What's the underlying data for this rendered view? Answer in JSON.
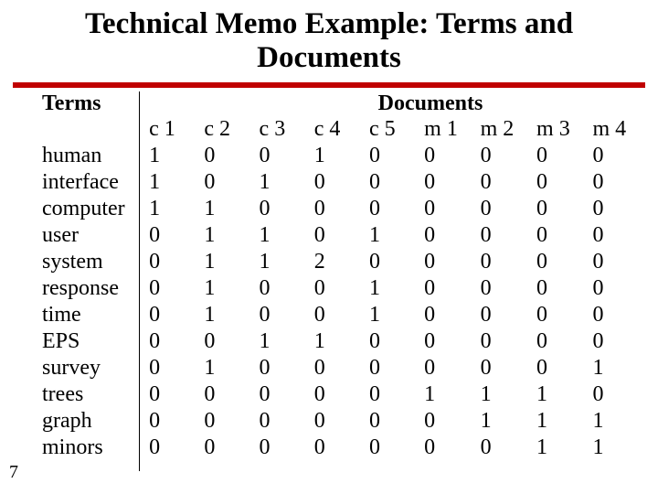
{
  "title_line1": "Technical Memo Example: Terms and",
  "title_line2": "Documents",
  "header_terms": "Terms",
  "header_docs": "Documents",
  "page_number": "7",
  "columns": [
    "c 1",
    "c 2",
    "c 3",
    "c 4",
    "c 5",
    "m 1",
    "m 2",
    "m 3",
    "m 4"
  ],
  "rows": [
    {
      "term": "human",
      "v": [
        "1",
        "0",
        "0",
        "1",
        "0",
        "0",
        "0",
        "0",
        "0"
      ]
    },
    {
      "term": "interface",
      "v": [
        "1",
        "0",
        "1",
        "0",
        "0",
        "0",
        "0",
        "0",
        "0"
      ]
    },
    {
      "term": "computer",
      "v": [
        "1",
        "1",
        "0",
        "0",
        "0",
        "0",
        "0",
        "0",
        "0"
      ]
    },
    {
      "term": "user",
      "v": [
        "0",
        "1",
        "1",
        "0",
        "1",
        "0",
        "0",
        "0",
        "0"
      ]
    },
    {
      "term": "system",
      "v": [
        "0",
        "1",
        "1",
        "2",
        "0",
        "0",
        "0",
        "0",
        "0"
      ]
    },
    {
      "term": "response",
      "v": [
        "0",
        "1",
        "0",
        "0",
        "1",
        "0",
        "0",
        "0",
        "0"
      ]
    },
    {
      "term": "time",
      "v": [
        "0",
        "1",
        "0",
        "0",
        "1",
        "0",
        "0",
        "0",
        "0"
      ]
    },
    {
      "term": "EPS",
      "v": [
        "0",
        "0",
        "1",
        "1",
        "0",
        "0",
        "0",
        "0",
        "0"
      ]
    },
    {
      "term": "survey",
      "v": [
        "0",
        "1",
        "0",
        "0",
        "0",
        "0",
        "0",
        "0",
        "1"
      ]
    },
    {
      "term": "trees",
      "v": [
        "0",
        "0",
        "0",
        "0",
        "0",
        "1",
        "1",
        "1",
        "0"
      ]
    },
    {
      "term": "graph",
      "v": [
        "0",
        "0",
        "0",
        "0",
        "0",
        "0",
        "1",
        "1",
        "1"
      ]
    },
    {
      "term": "minors",
      "v": [
        "0",
        "0",
        "0",
        "0",
        "0",
        "0",
        "0",
        "1",
        "1"
      ]
    }
  ],
  "chart_data": {
    "type": "table",
    "title": "Technical Memo Example: Terms and Documents",
    "row_labels": [
      "human",
      "interface",
      "computer",
      "user",
      "system",
      "response",
      "time",
      "EPS",
      "survey",
      "trees",
      "graph",
      "minors"
    ],
    "col_labels": [
      "c 1",
      "c 2",
      "c 3",
      "c 4",
      "c 5",
      "m 1",
      "m 2",
      "m 3",
      "m 4"
    ],
    "values": [
      [
        1,
        0,
        0,
        1,
        0,
        0,
        0,
        0,
        0
      ],
      [
        1,
        0,
        1,
        0,
        0,
        0,
        0,
        0,
        0
      ],
      [
        1,
        1,
        0,
        0,
        0,
        0,
        0,
        0,
        0
      ],
      [
        0,
        1,
        1,
        0,
        1,
        0,
        0,
        0,
        0
      ],
      [
        0,
        1,
        1,
        2,
        0,
        0,
        0,
        0,
        0
      ],
      [
        0,
        1,
        0,
        0,
        1,
        0,
        0,
        0,
        0
      ],
      [
        0,
        1,
        0,
        0,
        1,
        0,
        0,
        0,
        0
      ],
      [
        0,
        0,
        1,
        1,
        0,
        0,
        0,
        0,
        0
      ],
      [
        0,
        1,
        0,
        0,
        0,
        0,
        0,
        0,
        1
      ],
      [
        0,
        0,
        0,
        0,
        0,
        1,
        1,
        1,
        0
      ],
      [
        0,
        0,
        0,
        0,
        0,
        0,
        1,
        1,
        1
      ],
      [
        0,
        0,
        0,
        0,
        0,
        0,
        0,
        1,
        1
      ]
    ]
  }
}
